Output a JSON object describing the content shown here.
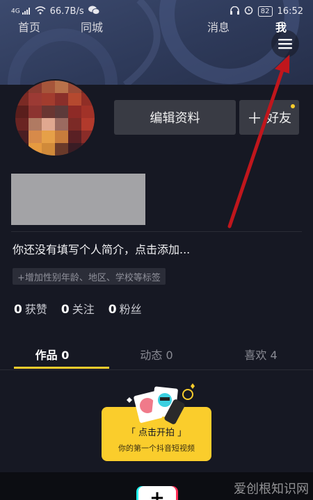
{
  "status_bar": {
    "signal": "4G",
    "speed": "66.7B/s",
    "battery": "82",
    "time": "16:52"
  },
  "header": {
    "menu_icon": "hamburger-menu-icon"
  },
  "profile": {
    "edit_button": "编辑资料",
    "add_friend_button": "好友",
    "add_friend_icon": "plus-icon",
    "bio_placeholder": "你还没有填写个人简介，点击添加...",
    "tag_hint": "+增加性别年龄、地区、学校等标签"
  },
  "stats": [
    {
      "count": "0",
      "label": "获赞"
    },
    {
      "count": "0",
      "label": "关注"
    },
    {
      "count": "0",
      "label": "粉丝"
    }
  ],
  "tabs": [
    {
      "label": "作品 0",
      "active": true
    },
    {
      "label": "动态 0",
      "active": false
    },
    {
      "label": "喜欢 4",
      "active": false
    }
  ],
  "shoot_card": {
    "title": "「 点击开拍 」",
    "subtitle": "你的第一个抖音短视频"
  },
  "bottom_nav": {
    "home": "首页",
    "nearby": "同城",
    "plus": "+",
    "messages": "消息",
    "me": "我"
  },
  "watermark": "爱创根知识网",
  "colors": {
    "background": "#161823",
    "accent": "#facd2c",
    "button": "#393b44",
    "annotation_arrow": "#c0161c"
  }
}
